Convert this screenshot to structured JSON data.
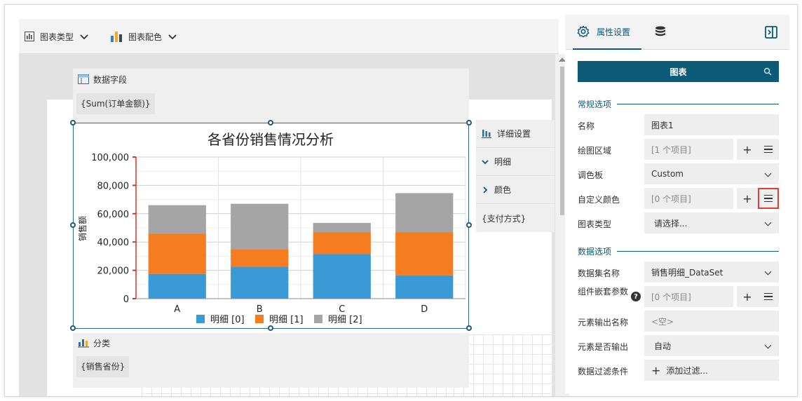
{
  "toolbar": {
    "chart_type_label": "图表类型",
    "chart_color_label": "图表配色"
  },
  "fields": {
    "data_field_title": "数据字段",
    "data_field_value": "{Sum(订单金额)}",
    "category_title": "分类",
    "category_value": "{销售省份}"
  },
  "detail": {
    "title": "详细设置",
    "detail_label": "明细",
    "color_label": "颜色",
    "color_value": "{支付方式}"
  },
  "chart_data": {
    "type": "bar",
    "stacked": true,
    "title": "各省份销售情况分析",
    "ylabel": "销售额",
    "xlabel": "",
    "categories": [
      "A",
      "B",
      "C",
      "D"
    ],
    "ylim": [
      0,
      100000
    ],
    "yticks": [
      "0",
      "20,000",
      "40,000",
      "60,000",
      "80,000",
      "100,000"
    ],
    "ytick_values": [
      0,
      20000,
      40000,
      60000,
      80000,
      100000
    ],
    "grid": true,
    "legend_position": "bottom",
    "series": [
      {
        "name": "明细 [0]",
        "color": "#3a9ad6",
        "values": [
          17500,
          22500,
          31500,
          16500
        ]
      },
      {
        "name": "明细 [1]",
        "color": "#f57c20",
        "values": [
          28500,
          12500,
          15500,
          30500
        ]
      },
      {
        "name": "明细 [2]",
        "color": "#a5a5a5",
        "values": [
          20000,
          32000,
          6500,
          27500
        ]
      }
    ]
  },
  "right_panel": {
    "tab_label": "属性设置",
    "search_title": "图表",
    "general_section": "常规选项",
    "data_section": "数据选项",
    "props": {
      "name_label": "名称",
      "name_value": "图表1",
      "plot_area_label": "绘图区域",
      "plot_area_value": "[1 个项目]",
      "palette_label": "调色板",
      "palette_value": "Custom",
      "custom_color_label": "自定义颜色",
      "custom_color_value": "[0 个项目]",
      "chart_type_label": "图表类型",
      "chart_type_value": "请选择...",
      "dataset_label": "数据集名称",
      "dataset_value": "销售明细_DataSet",
      "nested_param_label": "组件嵌套参数",
      "nested_param_value": "[0 个项目]",
      "output_name_label": "元素输出名称",
      "output_name_value": "<空>",
      "output_flag_label": "元素是否输出",
      "output_flag_value": "自动",
      "filter_label": "数据过滤条件",
      "filter_value": "添加过滤..."
    }
  },
  "colors": {
    "accent": "#0b5a78",
    "highlight": "#e03c31"
  }
}
